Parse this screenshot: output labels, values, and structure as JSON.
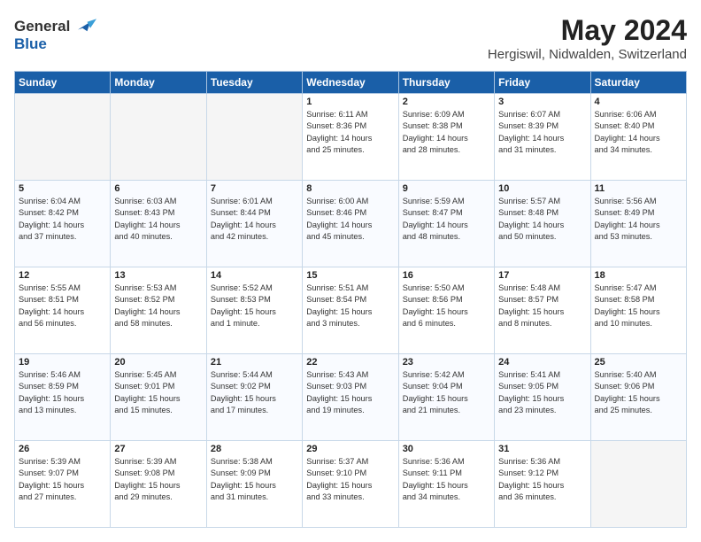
{
  "logo": {
    "general": "General",
    "blue": "Blue"
  },
  "title": "May 2024",
  "location": "Hergiswil, Nidwalden, Switzerland",
  "days_of_week": [
    "Sunday",
    "Monday",
    "Tuesday",
    "Wednesday",
    "Thursday",
    "Friday",
    "Saturday"
  ],
  "weeks": [
    [
      {
        "day": "",
        "content": ""
      },
      {
        "day": "",
        "content": ""
      },
      {
        "day": "",
        "content": ""
      },
      {
        "day": "1",
        "content": "Sunrise: 6:11 AM\nSunset: 8:36 PM\nDaylight: 14 hours\nand 25 minutes."
      },
      {
        "day": "2",
        "content": "Sunrise: 6:09 AM\nSunset: 8:38 PM\nDaylight: 14 hours\nand 28 minutes."
      },
      {
        "day": "3",
        "content": "Sunrise: 6:07 AM\nSunset: 8:39 PM\nDaylight: 14 hours\nand 31 minutes."
      },
      {
        "day": "4",
        "content": "Sunrise: 6:06 AM\nSunset: 8:40 PM\nDaylight: 14 hours\nand 34 minutes."
      }
    ],
    [
      {
        "day": "5",
        "content": "Sunrise: 6:04 AM\nSunset: 8:42 PM\nDaylight: 14 hours\nand 37 minutes."
      },
      {
        "day": "6",
        "content": "Sunrise: 6:03 AM\nSunset: 8:43 PM\nDaylight: 14 hours\nand 40 minutes."
      },
      {
        "day": "7",
        "content": "Sunrise: 6:01 AM\nSunset: 8:44 PM\nDaylight: 14 hours\nand 42 minutes."
      },
      {
        "day": "8",
        "content": "Sunrise: 6:00 AM\nSunset: 8:46 PM\nDaylight: 14 hours\nand 45 minutes."
      },
      {
        "day": "9",
        "content": "Sunrise: 5:59 AM\nSunset: 8:47 PM\nDaylight: 14 hours\nand 48 minutes."
      },
      {
        "day": "10",
        "content": "Sunrise: 5:57 AM\nSunset: 8:48 PM\nDaylight: 14 hours\nand 50 minutes."
      },
      {
        "day": "11",
        "content": "Sunrise: 5:56 AM\nSunset: 8:49 PM\nDaylight: 14 hours\nand 53 minutes."
      }
    ],
    [
      {
        "day": "12",
        "content": "Sunrise: 5:55 AM\nSunset: 8:51 PM\nDaylight: 14 hours\nand 56 minutes."
      },
      {
        "day": "13",
        "content": "Sunrise: 5:53 AM\nSunset: 8:52 PM\nDaylight: 14 hours\nand 58 minutes."
      },
      {
        "day": "14",
        "content": "Sunrise: 5:52 AM\nSunset: 8:53 PM\nDaylight: 15 hours\nand 1 minute."
      },
      {
        "day": "15",
        "content": "Sunrise: 5:51 AM\nSunset: 8:54 PM\nDaylight: 15 hours\nand 3 minutes."
      },
      {
        "day": "16",
        "content": "Sunrise: 5:50 AM\nSunset: 8:56 PM\nDaylight: 15 hours\nand 6 minutes."
      },
      {
        "day": "17",
        "content": "Sunrise: 5:48 AM\nSunset: 8:57 PM\nDaylight: 15 hours\nand 8 minutes."
      },
      {
        "day": "18",
        "content": "Sunrise: 5:47 AM\nSunset: 8:58 PM\nDaylight: 15 hours\nand 10 minutes."
      }
    ],
    [
      {
        "day": "19",
        "content": "Sunrise: 5:46 AM\nSunset: 8:59 PM\nDaylight: 15 hours\nand 13 minutes."
      },
      {
        "day": "20",
        "content": "Sunrise: 5:45 AM\nSunset: 9:01 PM\nDaylight: 15 hours\nand 15 minutes."
      },
      {
        "day": "21",
        "content": "Sunrise: 5:44 AM\nSunset: 9:02 PM\nDaylight: 15 hours\nand 17 minutes."
      },
      {
        "day": "22",
        "content": "Sunrise: 5:43 AM\nSunset: 9:03 PM\nDaylight: 15 hours\nand 19 minutes."
      },
      {
        "day": "23",
        "content": "Sunrise: 5:42 AM\nSunset: 9:04 PM\nDaylight: 15 hours\nand 21 minutes."
      },
      {
        "day": "24",
        "content": "Sunrise: 5:41 AM\nSunset: 9:05 PM\nDaylight: 15 hours\nand 23 minutes."
      },
      {
        "day": "25",
        "content": "Sunrise: 5:40 AM\nSunset: 9:06 PM\nDaylight: 15 hours\nand 25 minutes."
      }
    ],
    [
      {
        "day": "26",
        "content": "Sunrise: 5:39 AM\nSunset: 9:07 PM\nDaylight: 15 hours\nand 27 minutes."
      },
      {
        "day": "27",
        "content": "Sunrise: 5:39 AM\nSunset: 9:08 PM\nDaylight: 15 hours\nand 29 minutes."
      },
      {
        "day": "28",
        "content": "Sunrise: 5:38 AM\nSunset: 9:09 PM\nDaylight: 15 hours\nand 31 minutes."
      },
      {
        "day": "29",
        "content": "Sunrise: 5:37 AM\nSunset: 9:10 PM\nDaylight: 15 hours\nand 33 minutes."
      },
      {
        "day": "30",
        "content": "Sunrise: 5:36 AM\nSunset: 9:11 PM\nDaylight: 15 hours\nand 34 minutes."
      },
      {
        "day": "31",
        "content": "Sunrise: 5:36 AM\nSunset: 9:12 PM\nDaylight: 15 hours\nand 36 minutes."
      },
      {
        "day": "",
        "content": ""
      }
    ]
  ]
}
